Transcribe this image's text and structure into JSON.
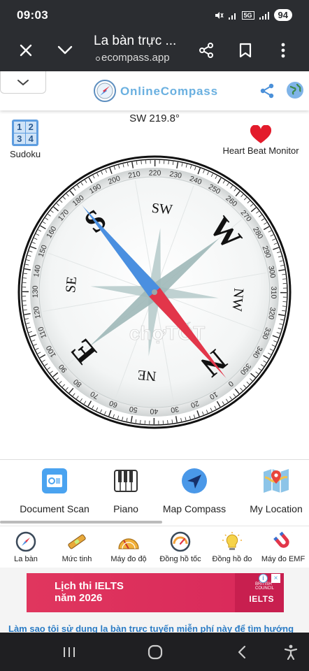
{
  "status_bar": {
    "time": "09:03",
    "signal_label": "5G",
    "battery": "94"
  },
  "browser": {
    "title": "La bàn trực ...",
    "url": "ecompass.app"
  },
  "site": {
    "name": "OnlineCompass"
  },
  "heading_readout": "SW 219.8°",
  "left_app": {
    "label": "Sudoku",
    "digits": [
      "1",
      "2",
      "3",
      "4"
    ]
  },
  "right_app": {
    "label": "Heart Beat Monitor"
  },
  "compass": {
    "heading_deg": 219.8,
    "cardinals": [
      "N",
      "NE",
      "E",
      "SE",
      "S",
      "SW",
      "W",
      "NW"
    ],
    "degree_labels": [
      "0",
      "10",
      "20",
      "30",
      "40",
      "50",
      "60",
      "70",
      "80",
      "90",
      "100",
      "110",
      "120",
      "130",
      "140",
      "150",
      "160",
      "170",
      "180",
      "190",
      "200",
      "210",
      "220",
      "230",
      "240",
      "250",
      "260",
      "270",
      "280",
      "290",
      "300",
      "310",
      "320",
      "330",
      "340",
      "350"
    ],
    "watermark": "chợTỐT",
    "colors": {
      "north_needle": "#e2364a",
      "south_needle": "#4a8fe0",
      "rose": "#9fb8b8",
      "ring": "#1a1a1a"
    }
  },
  "apps_row": [
    {
      "label": "Document Scan",
      "icon": "document-scan-icon"
    },
    {
      "label": "Piano",
      "icon": "piano-icon"
    },
    {
      "label": "Map Compass",
      "icon": "map-compass-icon"
    },
    {
      "label": "My Location",
      "icon": "my-location-icon"
    }
  ],
  "tools_row": [
    {
      "label": "La bàn",
      "icon": "compass-icon"
    },
    {
      "label": "Mức tinh",
      "icon": "level-icon"
    },
    {
      "label": "Máy đo độ",
      "icon": "protractor-icon"
    },
    {
      "label": "Đồng hồ tốc",
      "icon": "speedometer-icon"
    },
    {
      "label": "Đồng hồ đo",
      "icon": "lux-meter-icon"
    },
    {
      "label": "Máy đo EMF",
      "icon": "magnet-icon"
    }
  ],
  "ad": {
    "line1": "Lịch thi IELTS",
    "line2": "năm 2026",
    "brand_small_1": "BRITISH",
    "brand_small_2": "COUNCIL",
    "brand": "IELTS",
    "info": "i",
    "close": "×"
  },
  "article_link": "Làm sao tôi sử dụng la bàn trực tuyến miễn phí này để tìm hướng"
}
